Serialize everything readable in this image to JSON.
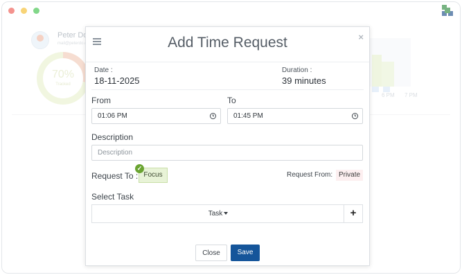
{
  "background": {
    "user_name": "Peter Do",
    "user_email": "mail@peterdo.com",
    "progress_percent_text": "70%",
    "progress_label": "Tracked",
    "progress_fraction": 0.7,
    "time_ticks": [
      "6 PM",
      "7 PM"
    ]
  },
  "modal": {
    "title": "Add Time Request",
    "close_glyph": "×",
    "date_label": "Date :",
    "date_value": "18-11-2025",
    "duration_label": "Duration :",
    "duration_value": "39 minutes",
    "from_label": "From",
    "from_value": "01:06 PM",
    "to_label": "To",
    "to_value": "01:45 PM",
    "description_label": "Description",
    "description_placeholder": "Description",
    "request_to_label": "Request To :",
    "request_to_value": "Focus",
    "request_from_label": "Request From:",
    "request_from_value": "Private",
    "select_task_label": "Select Task",
    "task_dropdown_value": "Task",
    "add_task_glyph": "+",
    "close_button_label": "Close",
    "save_button_label": "Save"
  },
  "colors": {
    "save_button": "#15559a",
    "check_badge": "#6aa431",
    "focus_chip_bg": "#e8f3d7",
    "private_chip_bg": "#fdeff0"
  },
  "icons": [
    "menu-icon",
    "close-icon",
    "clock-icon",
    "check-icon",
    "plus-icon",
    "app-logo-icon"
  ]
}
